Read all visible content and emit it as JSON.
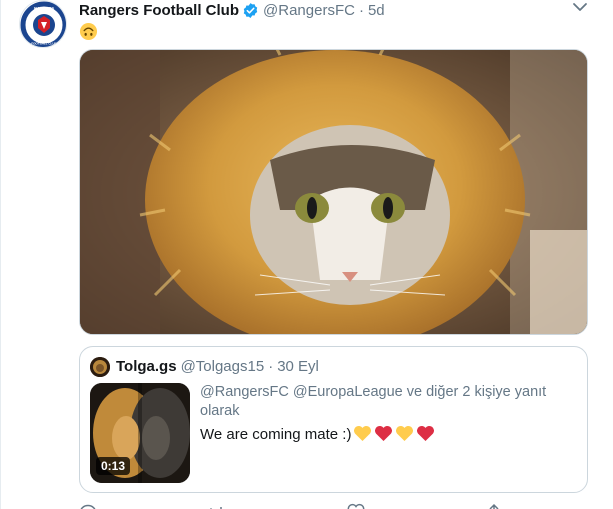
{
  "tweet": {
    "author_name": "Rangers Football Club",
    "handle": "@RangersFC",
    "separator": "·",
    "time": "5d",
    "emoji": "upside-down-face-emoji",
    "verified_color": "#1da1f2"
  },
  "avatar": {
    "logo_top_text": "RANGERS",
    "logo_bottom_text": "FOOTBALL CLUB"
  },
  "media": {
    "icon": "cat-in-lion-mane-photo"
  },
  "quote": {
    "author_name": "Tolga.gs",
    "handle": "@Tolgags15",
    "separator": "·",
    "date": "30 Eyl",
    "reply_line": "@RangersFC @EuropaLeague  ve diğer 2 kişiye yanıt olarak",
    "text": "We are coming mate :)",
    "emojis": [
      "yellow-heart",
      "red-heart",
      "yellow-heart",
      "red-heart"
    ],
    "video_duration": "0:13"
  },
  "colors": {
    "accent": "#1da1f2",
    "secondary_text": "#657786",
    "border": "#ccd6dd",
    "yellow_heart": "#ffcc4d",
    "red_heart": "#dd2e44"
  }
}
